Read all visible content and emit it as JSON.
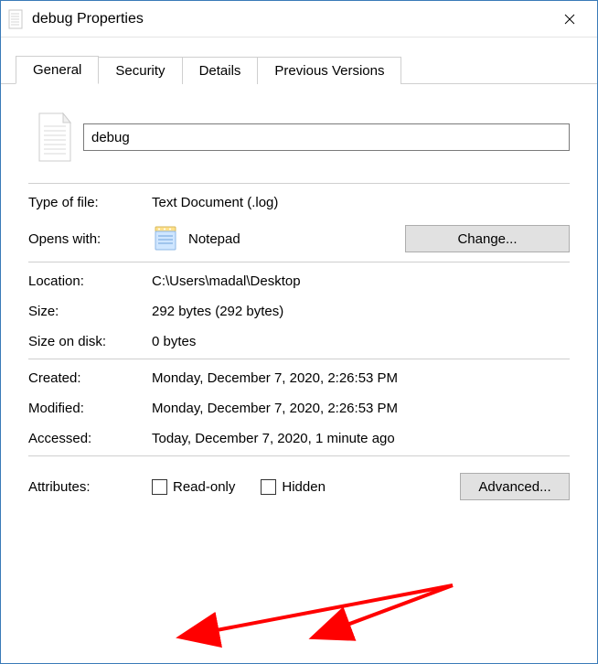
{
  "window": {
    "title": "debug Properties"
  },
  "tabs": {
    "general": "General",
    "security": "Security",
    "details": "Details",
    "previousVersions": "Previous Versions"
  },
  "filename": "debug",
  "labels": {
    "typeOfFile": "Type of file:",
    "opensWith": "Opens with:",
    "location": "Location:",
    "size": "Size:",
    "sizeOnDisk": "Size on disk:",
    "created": "Created:",
    "modified": "Modified:",
    "accessed": "Accessed:",
    "attributes": "Attributes:"
  },
  "values": {
    "typeOfFile": "Text Document (.log)",
    "opensWith": "Notepad",
    "location": "C:\\Users\\madal\\Desktop",
    "size": "292 bytes (292 bytes)",
    "sizeOnDisk": "0 bytes",
    "created": "Monday, December 7, 2020, 2:26:53 PM",
    "modified": "Monday, December 7, 2020, 2:26:53 PM",
    "accessed": "Today, December 7, 2020, 1 minute ago"
  },
  "buttons": {
    "change": "Change...",
    "advanced": "Advanced..."
  },
  "attributes": {
    "readonly": "Read-only",
    "hidden": "Hidden"
  }
}
